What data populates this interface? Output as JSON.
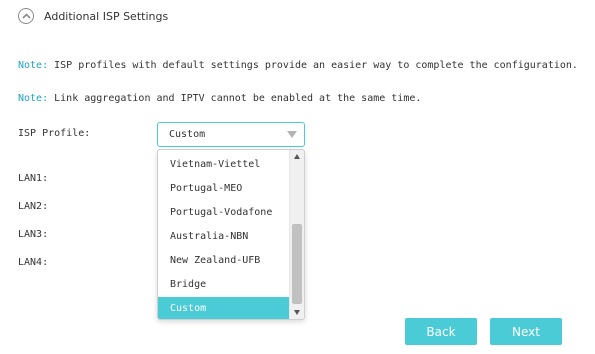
{
  "section": {
    "title": "Additional ISP Settings",
    "collapse_icon": "chevron-up-circle-icon"
  },
  "notes": [
    {
      "label": "Note:",
      "text": "ISP profiles with default settings provide an easier way to complete the configuration."
    },
    {
      "label": "Note:",
      "text": "Link aggregation and IPTV cannot be enabled at the same time."
    }
  ],
  "isp_profile": {
    "label": "ISP Profile:",
    "value": "Custom",
    "options": [
      "Vietnam-Viettel",
      "Portugal-MEO",
      "Portugal-Vodafone",
      "Australia-NBN",
      "New Zealand-UFB",
      "Bridge",
      "Custom"
    ],
    "selected_index": 6
  },
  "lan_labels": [
    "LAN1:",
    "LAN2:",
    "LAN3:",
    "LAN4:"
  ],
  "buttons": {
    "back": "Back",
    "next": "Next"
  },
  "colors": {
    "accent": "#4acbd6",
    "note_label": "#1fa3c4",
    "text": "#333333"
  }
}
